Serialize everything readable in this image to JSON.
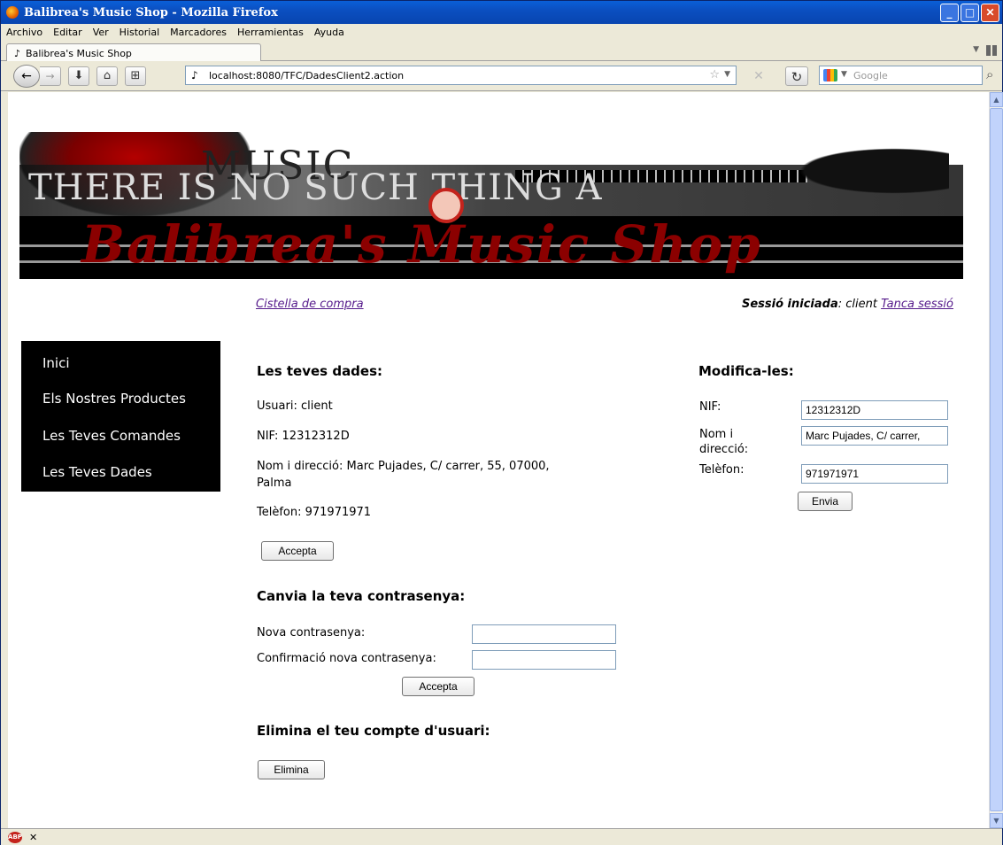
{
  "window": {
    "title": "Balibrea's Music Shop - Mozilla Firefox"
  },
  "menubar": {
    "items": [
      "Archivo",
      "Editar",
      "Ver",
      "Historial",
      "Marcadores",
      "Herramientas",
      "Ayuda"
    ]
  },
  "tab": {
    "title": "Balibrea's Music Shop"
  },
  "navbar": {
    "url": "localhost:8080/TFC/DadesClient2.action",
    "search_placeholder": "Google"
  },
  "banner": {
    "top_text": "MUSIC",
    "sub_text": "THERE IS NO SUCH THING A",
    "title": "Balibrea's Music Shop"
  },
  "header": {
    "cart_link": "Cistella de compra",
    "session_label": "Sessió iniciada",
    "session_user": ": client",
    "logout_link": "Tanca sessió"
  },
  "sidebar": {
    "items": [
      {
        "label": "Inici"
      },
      {
        "label": "Els Nostres Productes"
      },
      {
        "label": "Les Teves Comandes"
      },
      {
        "label": "Les Teves Dades"
      }
    ]
  },
  "your_data": {
    "heading": "Les teves dades:",
    "user": "Usuari: client",
    "nif": "NIF: 12312312D",
    "address_line1": "Nom i direcció: Marc Pujades, C/ carrer, 55, 07000,",
    "address_line2": "Palma",
    "phone": "Telèfon: 971971971",
    "accept_button": "Accepta"
  },
  "modify": {
    "heading": "Modifica-les:",
    "nif_label": "NIF:",
    "nif_value": "12312312D",
    "name_label_1": "Nom i",
    "name_label_2": "direcció:",
    "name_value": "Marc Pujades, C/ carrer,",
    "phone_label": "Telèfon:",
    "phone_value": "971971971",
    "send_button": "Envia"
  },
  "password": {
    "heading": "Canvia la teva contrasenya:",
    "new_label": "Nova contrasenya:",
    "confirm_label": "Confirmació nova contrasenya:",
    "accept_button": "Accepta"
  },
  "delete_account": {
    "heading": "Elimina el teu compte d'usuari:",
    "delete_button": "Elimina"
  },
  "icons": {
    "firefox": "firefox-icon",
    "adblock": "adblock-icon"
  }
}
